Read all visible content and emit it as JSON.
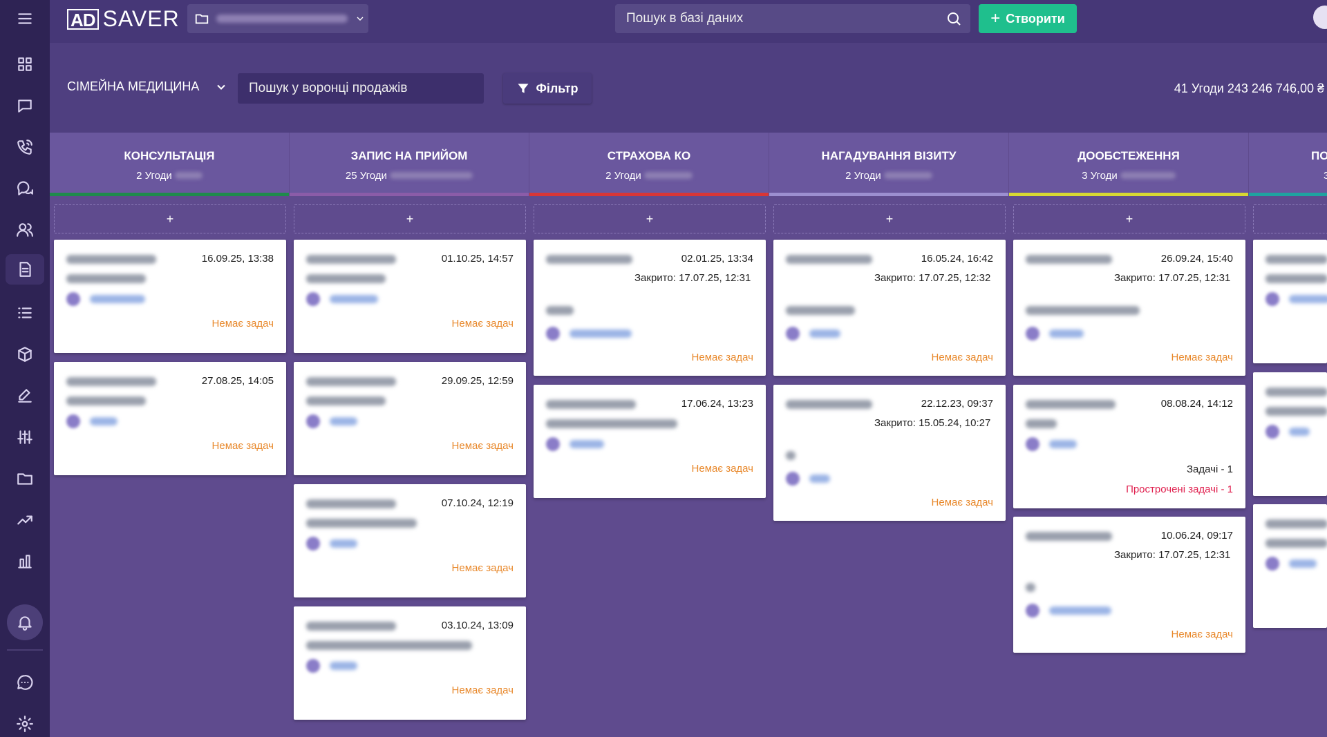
{
  "header": {
    "logo_mark": "AD",
    "logo_text": "SAVER",
    "search_placeholder": "Пошук в базі даних",
    "create_label": "Створити"
  },
  "toolbar": {
    "pipeline": "СІМЕЙНА МЕДИЦИНА",
    "funnel_search_placeholder": "Пошук у воронці продажів",
    "filter_label": "Фільтр",
    "totals": "41 Угоди 243 246 746,00 ₴"
  },
  "columns": [
    {
      "title": "КОНСУЛЬТАЦІЯ",
      "count": "2 Угоди",
      "color": "#1f8a4c"
    },
    {
      "title": "ЗАПИС НА ПРИЙОМ",
      "count": "25 Угоди",
      "color": "#8b5ca8"
    },
    {
      "title": "СТРАХОВА КО",
      "count": "2 Угоди",
      "color": "#d93636"
    },
    {
      "title": "НАГАДУВАННЯ ВІЗИТУ",
      "count": "2 Угоди",
      "color": "#9c8fd0"
    },
    {
      "title": "ДООБСТЕЖЕННЯ",
      "count": "3 Угоди",
      "color": "#d8d832"
    },
    {
      "title": "ПО",
      "count": "3",
      "color": "#1fa3a0"
    }
  ],
  "add_label": "+",
  "cards": {
    "c0_0": {
      "date": "16.09.25, 13:38",
      "tasks": "Немає задач"
    },
    "c0_1": {
      "date": "27.08.25, 14:05",
      "tasks": "Немає задач"
    },
    "c1_0": {
      "date": "01.10.25, 14:57",
      "tasks": "Немає задач"
    },
    "c1_1": {
      "date": "29.09.25, 12:59",
      "tasks": "Немає задач"
    },
    "c1_2": {
      "date": "07.10.24, 12:19",
      "tasks": "Немає задач"
    },
    "c1_3": {
      "date": "03.10.24, 13:09",
      "tasks": "Немає задач"
    },
    "c2_0": {
      "date": "02.01.25, 13:34",
      "closed": "Закрито: 17.07.25, 12:31",
      "tasks": "Немає задач"
    },
    "c2_1": {
      "date": "17.06.24, 13:23",
      "tasks": "Немає задач"
    },
    "c3_0": {
      "date": "16.05.24, 16:42",
      "closed": "Закрито: 17.07.25, 12:32",
      "tasks": "Немає задач"
    },
    "c3_1": {
      "date": "22.12.23, 09:37",
      "closed": "Закрито: 15.05.24, 10:27",
      "tasks": "Немає задач"
    },
    "c4_0": {
      "date": "26.09.24, 15:40",
      "closed": "Закрито: 17.07.25, 12:31",
      "tasks": "Немає задач"
    },
    "c4_1": {
      "date": "08.08.24, 14:12",
      "tasks_count": "Задачі - 1",
      "overdue": "Прострочені задачі - 1"
    },
    "c4_2": {
      "date": "10.06.24, 09:17",
      "closed": "Закрито: 17.07.25, 12:31",
      "tasks": "Немає задач"
    }
  }
}
